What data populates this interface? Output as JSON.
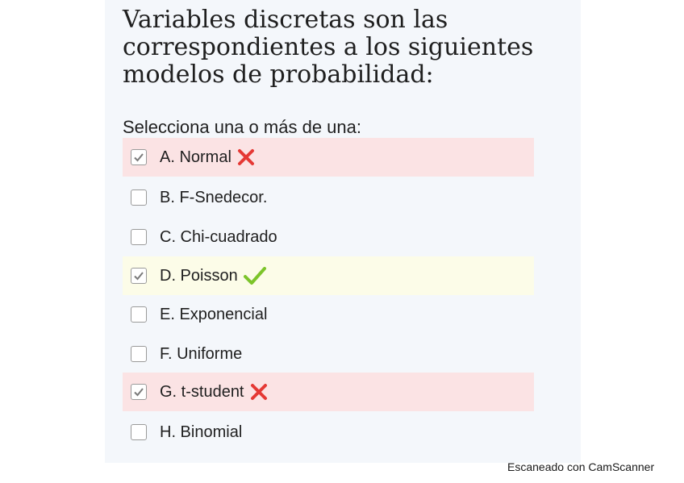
{
  "question": {
    "title": "Variables discretas son las correspondientes a los siguientes modelos de probabilidad:",
    "prompt": "Selecciona una o más de una:"
  },
  "options": [
    {
      "label": "A. Normal",
      "checked": true,
      "result": "wrong"
    },
    {
      "label": "B. F-Snedecor.",
      "checked": false,
      "result": ""
    },
    {
      "label": "C. Chi-cuadrado",
      "checked": false,
      "result": ""
    },
    {
      "label": "D. Poisson",
      "checked": true,
      "result": "right"
    },
    {
      "label": "E. Exponencial",
      "checked": false,
      "result": ""
    },
    {
      "label": "F. Uniforme",
      "checked": false,
      "result": ""
    },
    {
      "label": "G. t-student",
      "checked": true,
      "result": "wrong"
    },
    {
      "label": "H. Binomial",
      "checked": false,
      "result": ""
    }
  ],
  "icons": {
    "check": "check-icon",
    "wrong": "cross-icon",
    "right": "checkmark-icon"
  },
  "colors": {
    "wrong_bg": "#fbe3e4",
    "right_bg": "#fcfce8",
    "cross": "#e53935",
    "tick": "#7cc42a"
  },
  "footer": {
    "text": "Escaneado con CamScanner"
  }
}
